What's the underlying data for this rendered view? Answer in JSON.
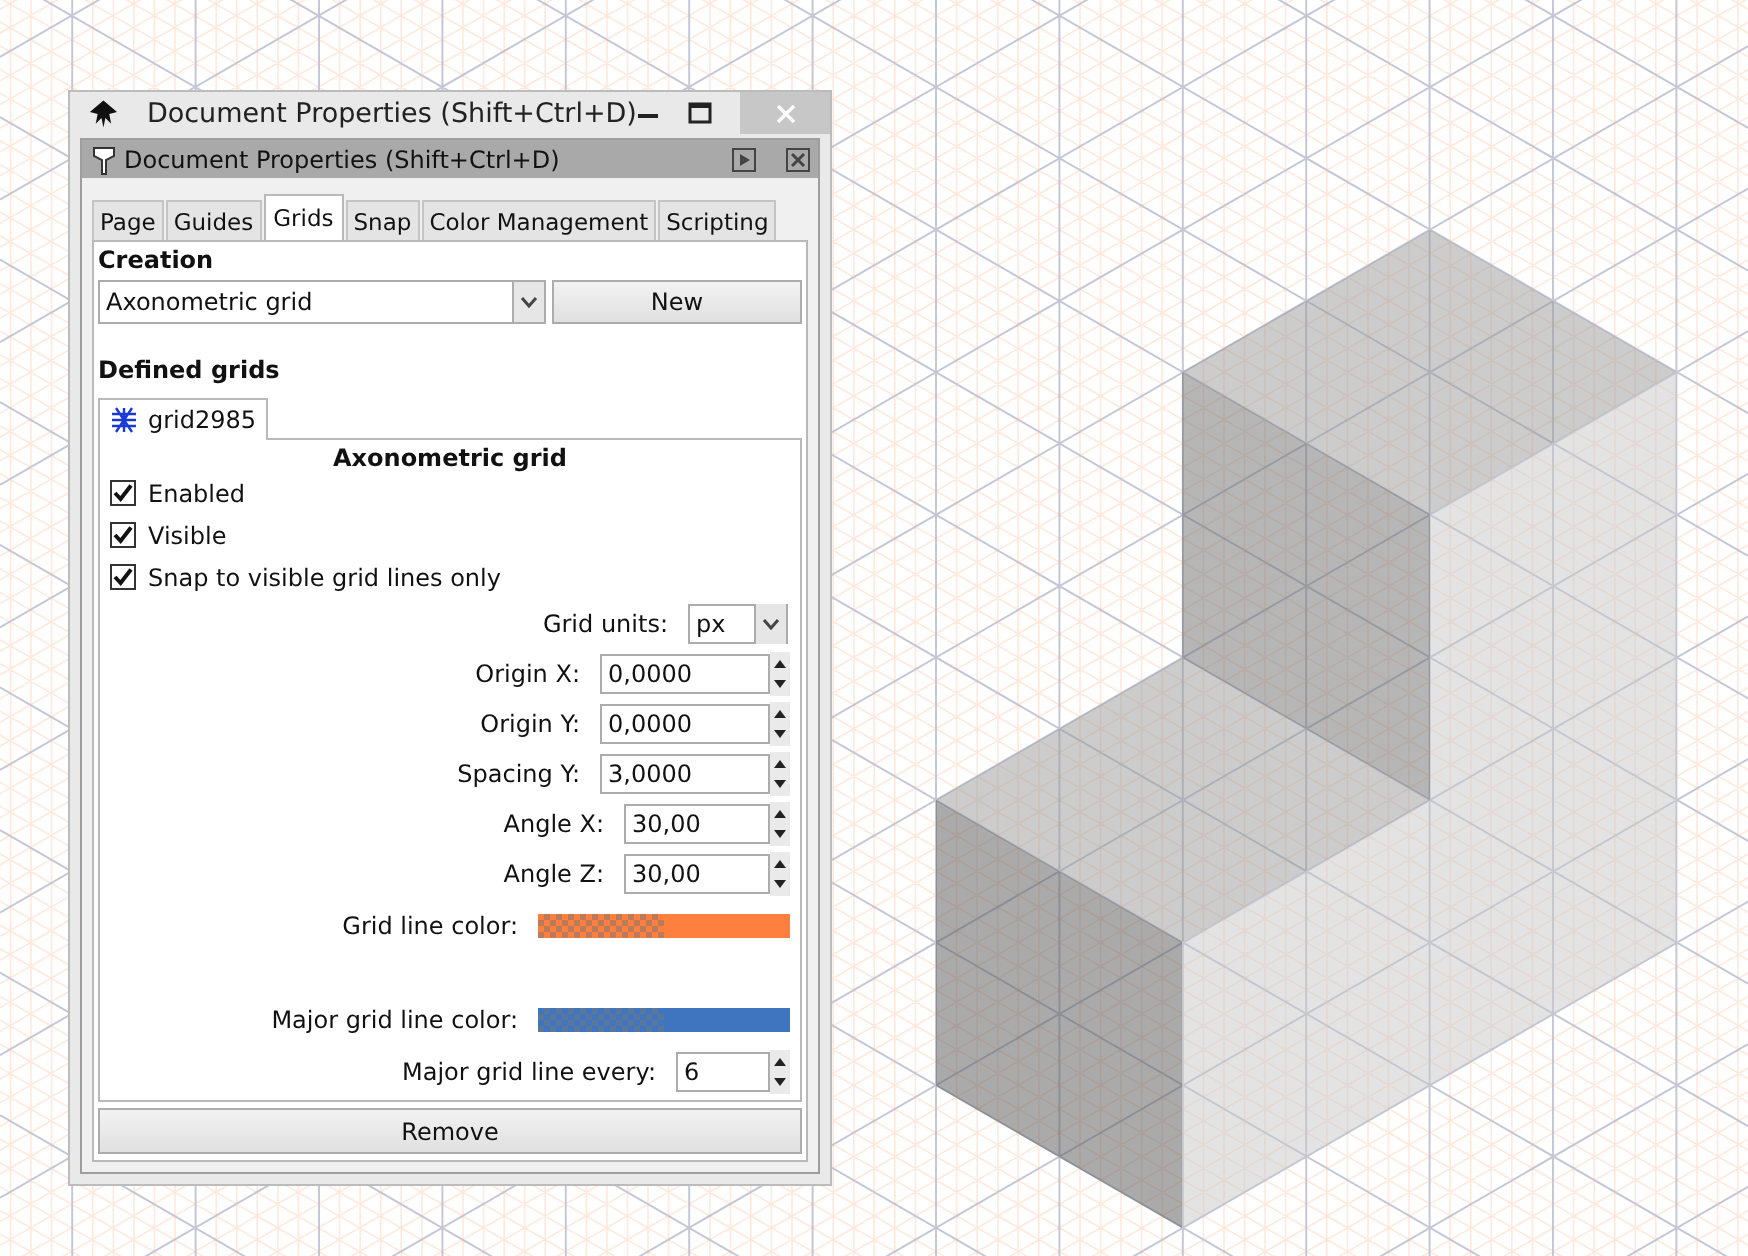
{
  "window": {
    "title": "Document Properties (Shift+Ctrl+D)"
  },
  "panel": {
    "title": "Document Properties (Shift+Ctrl+D)"
  },
  "tabs": [
    {
      "label": "Page",
      "selected": false
    },
    {
      "label": "Guides",
      "selected": false
    },
    {
      "label": "Grids",
      "selected": true
    },
    {
      "label": "Snap",
      "selected": false
    },
    {
      "label": "Color Management",
      "selected": false
    },
    {
      "label": "Scripting",
      "selected": false
    }
  ],
  "creation": {
    "heading": "Creation",
    "grid_type": "Axonometric grid",
    "new_button": "New"
  },
  "defined_grids": {
    "heading": "Defined grids",
    "tabs": [
      {
        "label": "grid2985",
        "selected": true
      }
    ]
  },
  "grid": {
    "title": "Axonometric grid",
    "checkboxes": [
      {
        "label": "Enabled",
        "checked": true
      },
      {
        "label": "Visible",
        "checked": true
      },
      {
        "label": "Snap to visible grid lines only",
        "checked": true
      }
    ],
    "fields": [
      {
        "kind": "select",
        "label": "Grid units:",
        "value": "px"
      },
      {
        "kind": "spin",
        "label": "Origin X:",
        "value": "0,0000"
      },
      {
        "kind": "spin",
        "label": "Origin Y:",
        "value": "0,0000"
      },
      {
        "kind": "spin",
        "label": "Spacing Y:",
        "value": "3,0000"
      },
      {
        "kind": "spin",
        "label": "Angle X:",
        "value": "30,00"
      },
      {
        "kind": "spin",
        "label": "Angle Z:",
        "value": "30,00"
      },
      {
        "kind": "color",
        "label": "Grid line color:",
        "color": "#ff7f3f"
      },
      {
        "kind": "color",
        "label": "Major grid line color:",
        "color": "#3f75bf"
      },
      {
        "kind": "spin",
        "label": "Major grid line every:",
        "value": "6"
      }
    ]
  },
  "remove_button": "Remove"
}
